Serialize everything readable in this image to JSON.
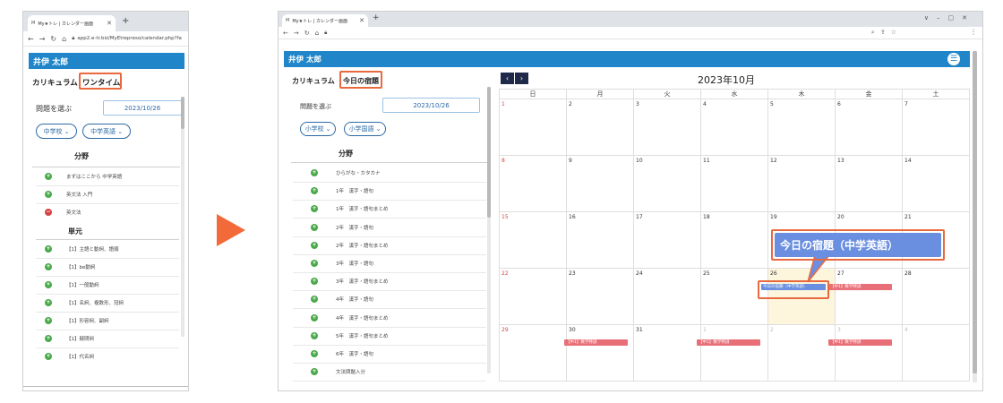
{
  "browser": {
    "tab_title": "My★トレ | カレンダー画面",
    "favicon_text": "M",
    "left_url": "app2.e-tr.biz/MyEtrepreso/calendar.php?fa",
    "window_controls": [
      "∨",
      "–",
      "▢",
      "✕"
    ]
  },
  "app": {
    "user_name": "井伊 太郎",
    "tab_curriculum": "カリキュラム",
    "tab_onetime": "ワンタイム",
    "tab_today_homework": "今日の宿題",
    "choose_problem_label": "問題を選ぶ",
    "date_value": "2023/10/26",
    "section_field": "分野",
    "section_unit": "単元"
  },
  "left_panel": {
    "selects": [
      "中学校",
      "中学英語"
    ],
    "fields": [
      {
        "label": "まずはここから 中学英語",
        "icon": "plus"
      },
      {
        "label": "英文法 入門",
        "icon": "plus"
      },
      {
        "label": "英文法",
        "icon": "minus"
      }
    ],
    "units": [
      "【1】主語と動詞、語順",
      "【1】be動詞",
      "【1】一般動詞",
      "【1】名詞、複数形、冠詞",
      "【1】形容詞、副詞",
      "【1】疑問詞",
      "【1】代名詞"
    ]
  },
  "right_panel": {
    "selects": [
      "小学校",
      "小学国語"
    ],
    "fields": [
      "ひらがな・カタカナ",
      "1年　漢字・語句",
      "1年　漢字・語句まとめ",
      "2年　漢字・語句",
      "2年　漢字・語句まとめ",
      "3年　漢字・語句",
      "3年　漢字・語句まとめ",
      "4年　漢字・語句",
      "4年　漢字・語句まとめ",
      "5年　漢字・語句まとめ",
      "6年　漢字・語句",
      "文法問題入分"
    ]
  },
  "calendar": {
    "title": "2023年10月",
    "prev": "‹",
    "next": "›",
    "weekdays": [
      "日",
      "月",
      "火",
      "水",
      "木",
      "金",
      "土"
    ],
    "weeks": [
      [
        "1",
        "2",
        "3",
        "4",
        "5",
        "6",
        "7"
      ],
      [
        "8",
        "9",
        "10",
        "11",
        "12",
        "13",
        "14"
      ],
      [
        "15",
        "16",
        "17",
        "18",
        "19",
        "20",
        "21"
      ],
      [
        "22",
        "23",
        "24",
        "25",
        "26",
        "27",
        "28"
      ],
      [
        "29",
        "30",
        "31",
        "1",
        "2",
        "3",
        "4"
      ]
    ],
    "events": {
      "homework": "今日の宿題（中学英語）",
      "math_special": "【中1】数学特訓"
    },
    "callout": "今日の宿題（中学英語）"
  },
  "address_right_icons": [
    "⌕",
    "⇪",
    "☆"
  ],
  "colors": {
    "brand": "#2186c9",
    "highlight": "#e9693f",
    "event_red": "#e86f77",
    "event_blue": "#6a8fe0"
  }
}
